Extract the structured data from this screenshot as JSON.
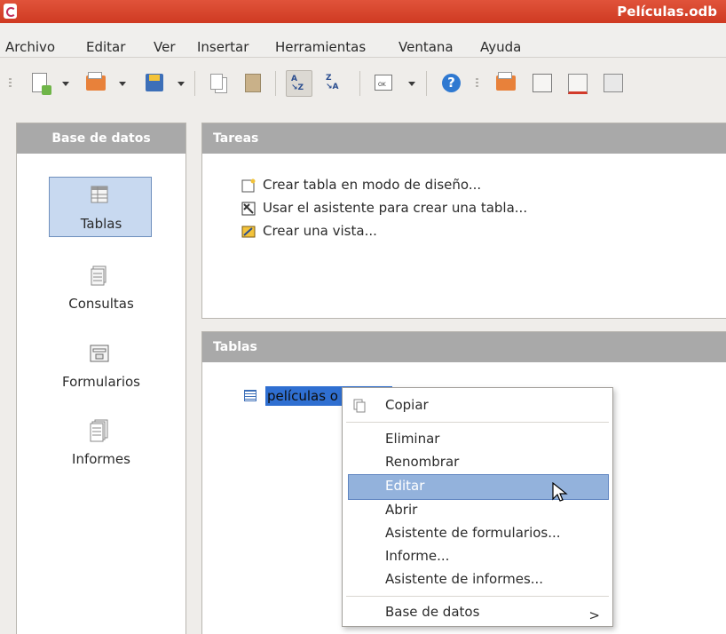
{
  "window": {
    "title": "Películas.odb"
  },
  "menubar": {
    "items": [
      "Archivo",
      "Editar",
      "Ver",
      "Insertar",
      "Herramientas",
      "Ventana",
      "Ayuda"
    ]
  },
  "toolbar": {
    "icons": [
      "new-document-icon",
      "open-icon",
      "save-icon",
      "copy-icon",
      "paste-icon",
      "sort-ascending-icon",
      "sort-descending-icon",
      "form-icon",
      "help-icon",
      "table-icon",
      "edit-icon",
      "delete-icon",
      "rename-icon"
    ]
  },
  "sidebar": {
    "title": "Base de datos",
    "items": [
      {
        "label": "Tablas",
        "icon": "tables-icon",
        "active": true
      },
      {
        "label": "Consultas",
        "icon": "queries-icon",
        "active": false
      },
      {
        "label": "Formularios",
        "icon": "forms-icon",
        "active": false
      },
      {
        "label": "Informes",
        "icon": "reports-icon",
        "active": false
      }
    ]
  },
  "tasks": {
    "title": "Tareas",
    "items": [
      {
        "label": "Crear tabla en modo de diseño...",
        "icon": "table-design-icon"
      },
      {
        "label": "Usar el asistente para crear una tabla...",
        "icon": "wizard-icon"
      },
      {
        "label": "Crear una vista...",
        "icon": "view-icon"
      }
    ]
  },
  "tables": {
    "title": "Tablas",
    "items": [
      {
        "label": "películas o",
        "selected": true
      }
    ]
  },
  "context_menu": {
    "items": [
      "Copiar",
      "Eliminar",
      "Renombrar",
      "Editar",
      "Abrir",
      "Asistente de formularios...",
      "Informe...",
      "Asistente de informes...",
      "Base de datos"
    ],
    "highlighted": "Editar",
    "submenu_arrow": ">"
  },
  "colors": {
    "titlebar": "#d9432b",
    "panel_header": "#a9a9a9",
    "selection": "#2f6fd1",
    "menu_highlight": "#93b2dc"
  }
}
